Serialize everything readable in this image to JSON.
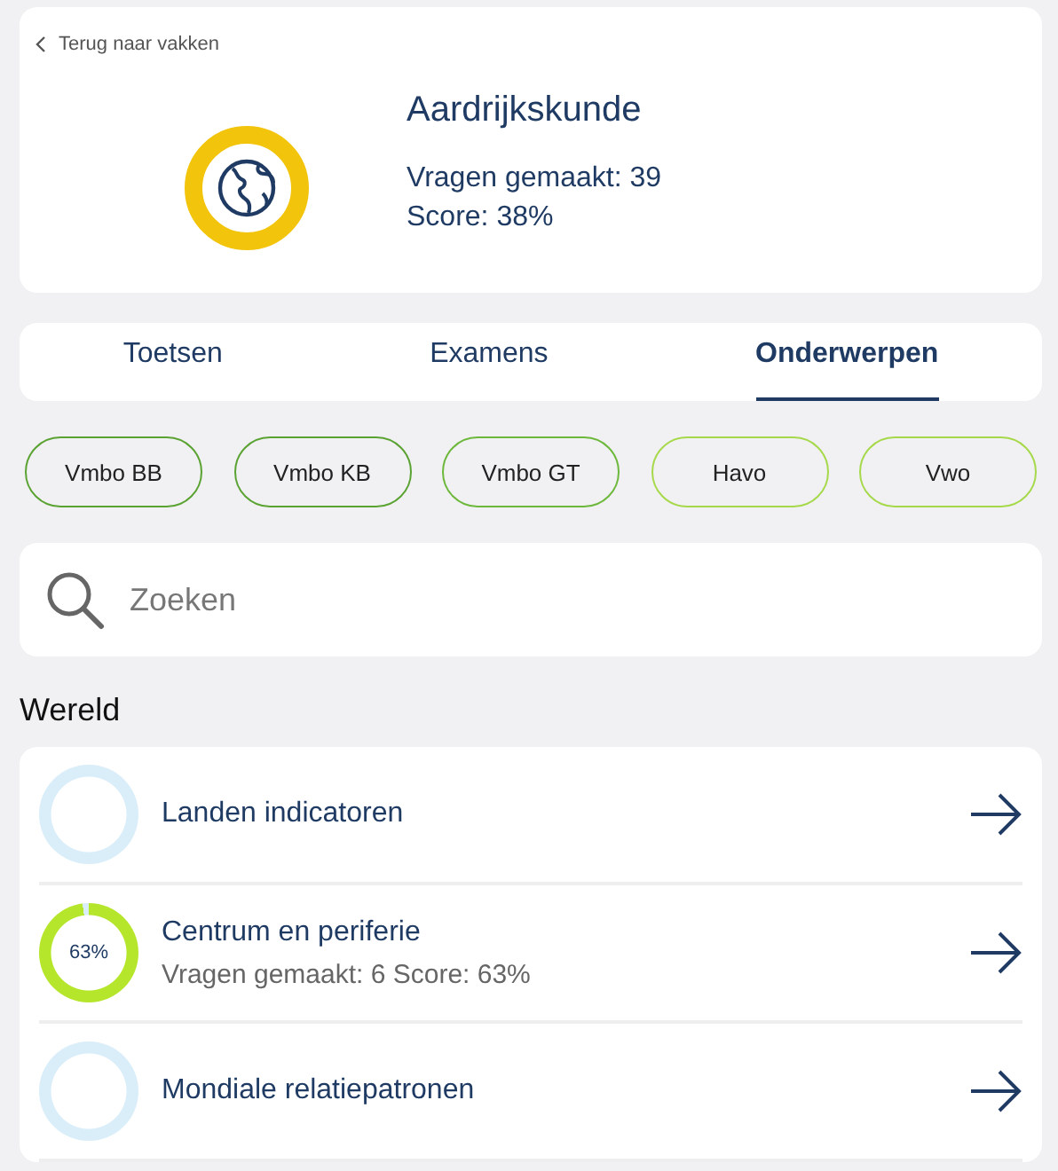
{
  "back_link": "Terug naar vakken",
  "subject": {
    "title": "Aardrijkskunde",
    "questions": "Vragen gemaakt: 39",
    "score": "Score: 38%"
  },
  "tabs": [
    {
      "label": "Toetsen",
      "selected": false
    },
    {
      "label": "Examens",
      "selected": false
    },
    {
      "label": "Onderwerpen",
      "selected": true
    }
  ],
  "levels": [
    {
      "label": "Vmbo BB",
      "color": "#5aa332"
    },
    {
      "label": "Vmbo KB",
      "color": "#5aa332"
    },
    {
      "label": "Vmbo GT",
      "color": "#6cb83a"
    },
    {
      "label": "Havo",
      "color": "#a6d94a"
    },
    {
      "label": "Vwo",
      "color": "#a6d94a"
    }
  ],
  "search": {
    "placeholder": "Zoeken"
  },
  "section_title": "Wereld",
  "topics": [
    {
      "title": "Landen indicatoren"
    },
    {
      "title": "Centrum en periferie",
      "percent": "63%",
      "details": "Vragen gemaakt: 6 Score: 63%"
    },
    {
      "title": "Mondiale relatiepatronen"
    }
  ]
}
